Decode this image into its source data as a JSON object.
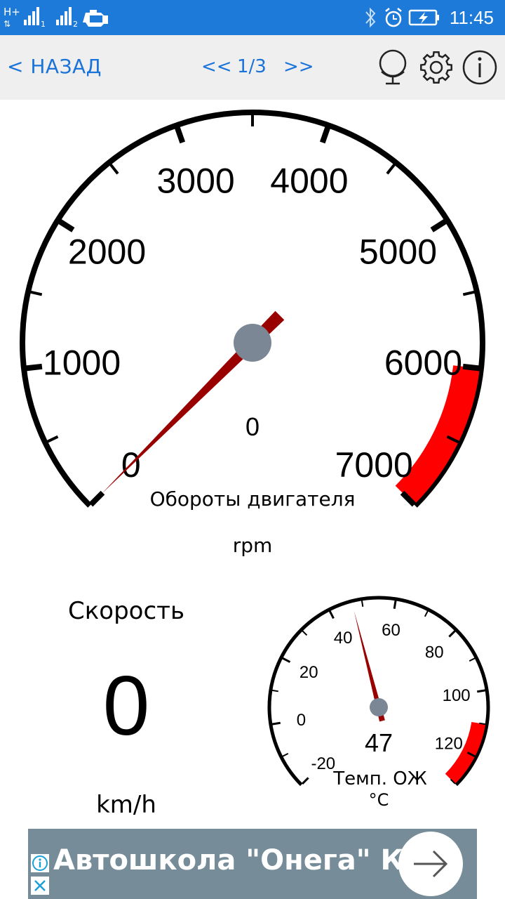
{
  "status_bar": {
    "network_label": "H+",
    "sim1_label": "1",
    "sim2_label": "2",
    "time": "11:45"
  },
  "nav": {
    "back_label": "< НАЗАД",
    "prev_label": "<<",
    "page_indicator": "1/3",
    "next_label": ">>",
    "icons": [
      "globe-stand-icon",
      "gear-icon",
      "info-icon"
    ]
  },
  "rpm_gauge": {
    "ticks": [
      "0",
      "1000",
      "2000",
      "3000",
      "4000",
      "5000",
      "6000",
      "7000"
    ],
    "min": 0,
    "max": 7000,
    "redline_start": 6000,
    "value": 0,
    "value_label": "0",
    "title": "Обороты двигателя",
    "unit": "rpm",
    "needle_color": "#990000",
    "redline_color": "#ff0000",
    "hub_color": "#7b8794"
  },
  "speed": {
    "title": "Скорость",
    "value": "0",
    "unit": "km/h"
  },
  "temp_gauge": {
    "ticks": [
      "-20",
      "0",
      "20",
      "40",
      "60",
      "80",
      "100",
      "120"
    ],
    "min": -20,
    "max": 130,
    "redline_start": 110,
    "value": 47,
    "value_label": "47",
    "title": "Темп. ОЖ",
    "unit": "°C",
    "needle_color": "#990000",
    "redline_color": "#ff0000"
  },
  "ad": {
    "text": "Автошкола \"Онега\" Ки",
    "background": "#768c98"
  }
}
